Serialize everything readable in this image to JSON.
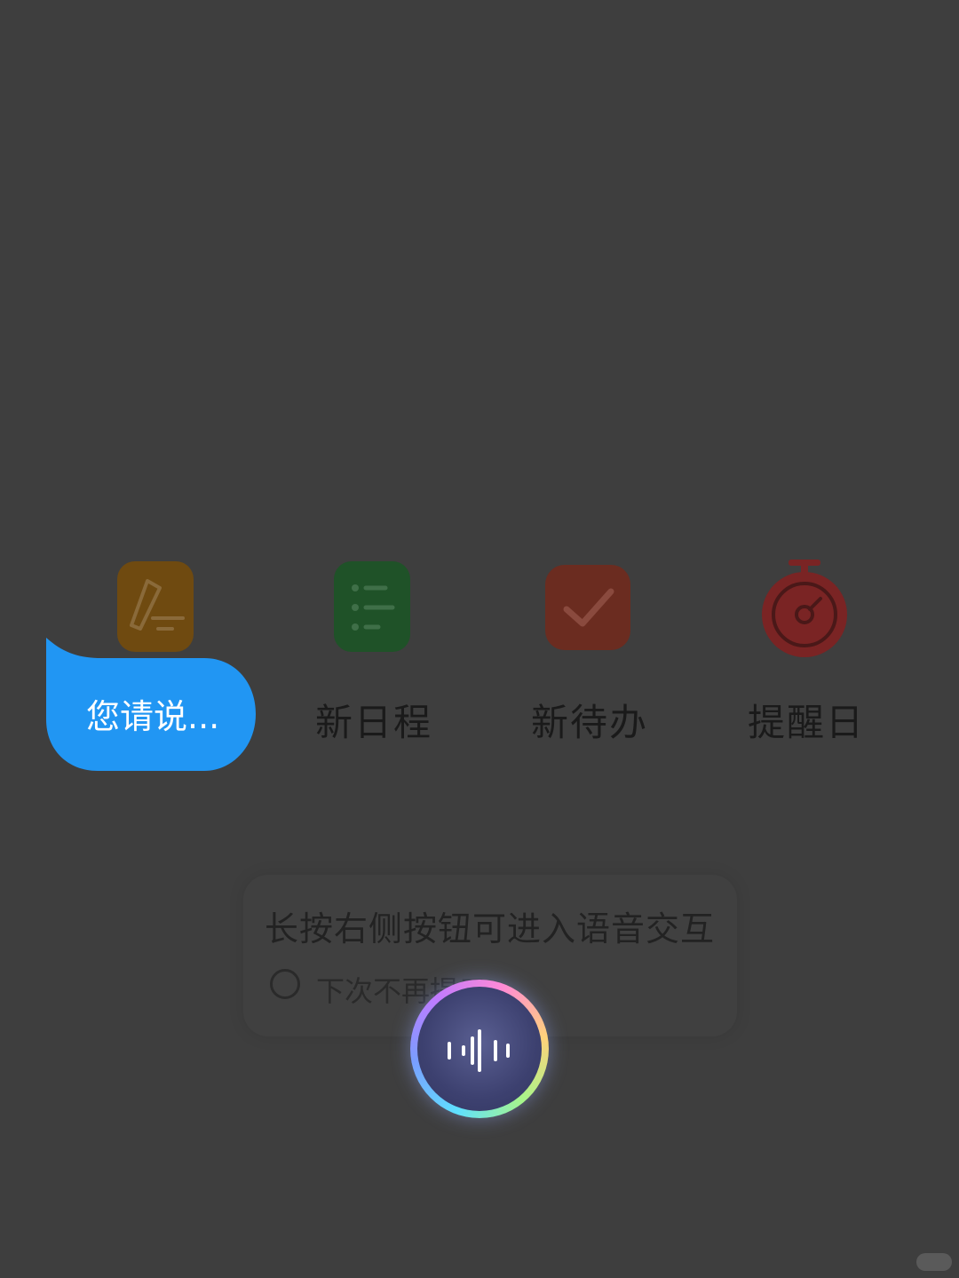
{
  "quick_actions": {
    "schedule_label": "新日程",
    "todo_label": "新待办",
    "remind_label": "提醒日"
  },
  "bubble": {
    "text": "您请说..."
  },
  "hint": {
    "title": "长按右侧按钮可进入语音交互",
    "checkbox_label": "下次不再提示"
  },
  "colors": {
    "bubble": "#2196f3",
    "note_tile": "#6f4a10",
    "schedule_tile": "#1f5228",
    "todo_tile": "#6b2c20",
    "stopwatch": "#7a2424"
  },
  "icons": {
    "note": "pen-note-icon",
    "schedule": "list-icon",
    "todo": "checkmark-icon",
    "remind": "stopwatch-icon",
    "voice": "voice-wave-icon"
  }
}
